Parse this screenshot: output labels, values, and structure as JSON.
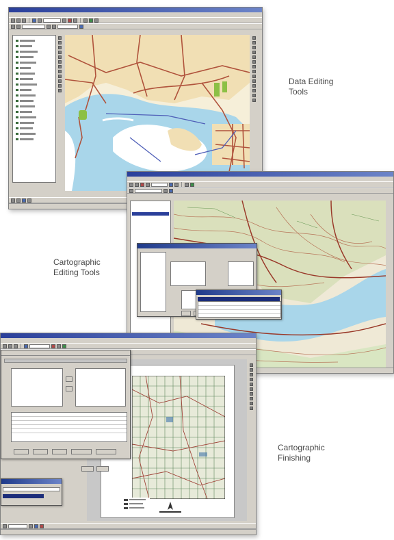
{
  "callouts": {
    "data_editing": [
      "Data Editing",
      "Tools"
    ],
    "cartographic_editing": [
      "Cartographic",
      "Editing Tools"
    ],
    "cartographic_finishing": [
      "Cartographic",
      "Finishing"
    ]
  },
  "colors": {
    "water": "#a9d6ea",
    "land": "#f1dfb4",
    "roads": "#b0533c",
    "topo_green": "#8fb57a",
    "titlebar": "#2a3f9a"
  }
}
